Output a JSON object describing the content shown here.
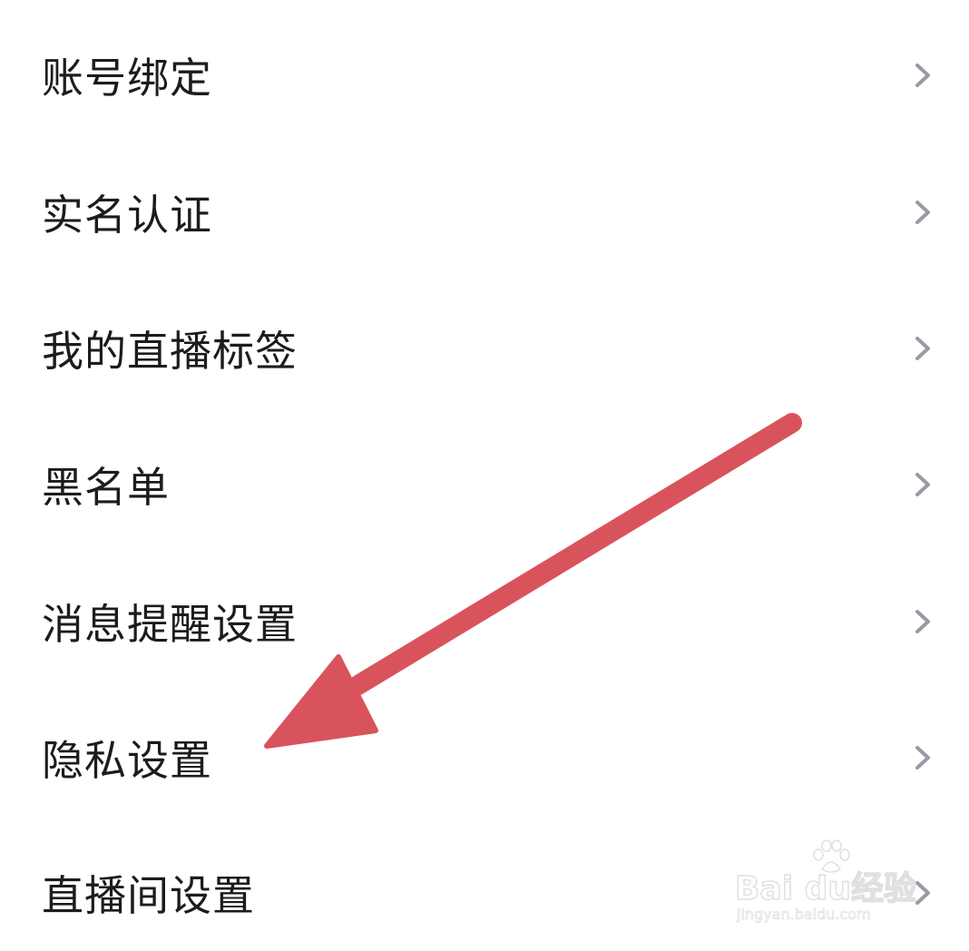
{
  "settings": {
    "items": [
      {
        "label": "账号绑定"
      },
      {
        "label": "实名认证"
      },
      {
        "label": "我的直播标签"
      },
      {
        "label": "黑名单"
      },
      {
        "label": "消息提醒设置"
      },
      {
        "label": "隐私设置"
      },
      {
        "label": "直播间设置"
      }
    ]
  },
  "icons": {
    "chevron": "chevron-right-icon",
    "annotation": "red-arrow-pointer"
  },
  "colors": {
    "text": "#1c1c1e",
    "chevron": "#9a9aa6",
    "annotation_arrow": "#d9535c",
    "background": "#ffffff"
  },
  "watermark": {
    "main": "Bai du经验",
    "sub": "jingyan.baidu.com"
  }
}
